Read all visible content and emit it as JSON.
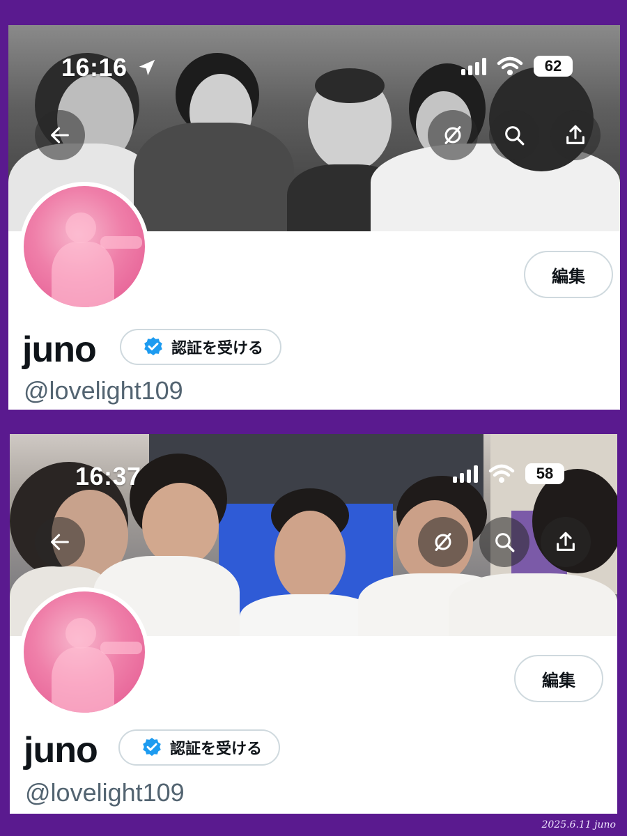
{
  "panels": [
    {
      "status": {
        "time": "16:16",
        "battery": "62",
        "location_icon": "location-arrow-icon",
        "signal_icon": "signal-bars-icon",
        "wifi_icon": "wifi-icon"
      },
      "header_buttons": [
        "back-arrow-icon",
        "grok-slash-icon",
        "search-icon",
        "share-upload-icon"
      ],
      "banner_style": "grayscale-photo",
      "edit_label": "編集",
      "display_name": "juno",
      "verify_label": "認証を受ける",
      "handle": "@lovelight109"
    },
    {
      "status": {
        "time": "16:37",
        "battery": "58",
        "signal_icon": "signal-bars-icon",
        "wifi_icon": "wifi-icon"
      },
      "header_buttons": [
        "back-arrow-icon",
        "grok-slash-icon",
        "search-icon",
        "share-upload-icon"
      ],
      "banner_style": "color-photo",
      "edit_label": "編集",
      "display_name": "juno",
      "verify_label": "認証を受ける",
      "handle": "@lovelight109"
    }
  ],
  "footer": {
    "signature": "2025.6.11  juno"
  },
  "colors": {
    "frame": "#5a1a8f",
    "verified_blue": "#1d9bf0",
    "handle_gray": "#536471",
    "avatar_pink": "#ef7fa9"
  }
}
